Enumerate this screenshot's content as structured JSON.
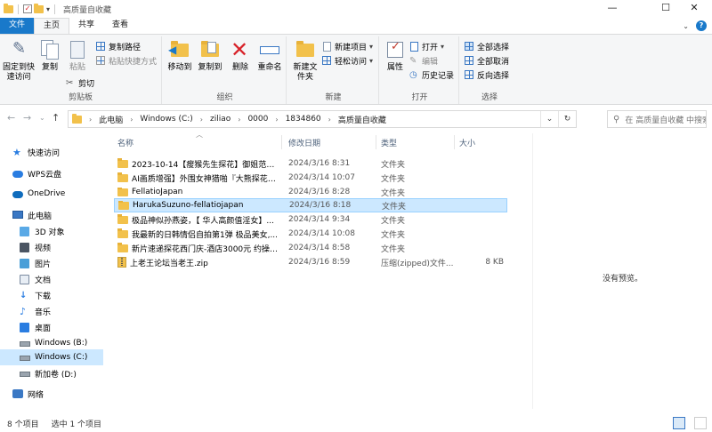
{
  "window": {
    "title": "高质量自收藏",
    "minimize": "—",
    "maximize": "☐",
    "close": "✕"
  },
  "tabs": [
    {
      "label": "文件"
    },
    {
      "label": "主页"
    },
    {
      "label": "共享"
    },
    {
      "label": "查看"
    }
  ],
  "ribbon": {
    "clipboard": {
      "label": "剪贴板",
      "pin": "固定到快速访问",
      "copy": "复制",
      "paste": "粘贴",
      "copy_path": "复制路径",
      "paste_shortcut": "粘贴快捷方式",
      "cut": "剪切"
    },
    "organize": {
      "label": "组织",
      "move_to": "移动到",
      "copy_to": "复制到",
      "delete": "删除",
      "rename": "重命名"
    },
    "new": {
      "label": "新建",
      "new_folder": "新建文件夹",
      "new_item": "新建项目",
      "easy_access": "轻松访问"
    },
    "open": {
      "label": "打开",
      "properties": "属性",
      "open": "打开",
      "edit": "编辑",
      "history": "历史记录"
    },
    "select": {
      "label": "选择",
      "select_all": "全部选择",
      "select_none": "全部取消",
      "invert": "反向选择"
    }
  },
  "address": {
    "crumbs": [
      "此电脑",
      "Windows (C:)",
      "ziliao",
      "0000",
      "1834860",
      "高质量自收藏"
    ],
    "search_placeholder": "在 高质量自收藏 中搜索"
  },
  "nav": [
    {
      "label": "快速访问",
      "icon": "star-icon"
    },
    {
      "label": "WPS云盘",
      "icon": "cloud-icon"
    },
    {
      "label": "OneDrive",
      "icon": "cloud-icon"
    },
    {
      "label": "此电脑",
      "icon": "computer-icon"
    },
    {
      "label": "3D 对象",
      "icon": "cube-icon"
    },
    {
      "label": "视频",
      "icon": "video-icon"
    },
    {
      "label": "图片",
      "icon": "picture-icon"
    },
    {
      "label": "文档",
      "icon": "document-icon"
    },
    {
      "label": "下载",
      "icon": "download-icon"
    },
    {
      "label": "音乐",
      "icon": "music-icon"
    },
    {
      "label": "桌面",
      "icon": "desktop-icon"
    },
    {
      "label": "Windows (B:)",
      "icon": "drive-icon"
    },
    {
      "label": "Windows (C:)",
      "icon": "drive-icon"
    },
    {
      "label": "新加卷 (D:)",
      "icon": "drive-icon"
    },
    {
      "label": "网络",
      "icon": "network-icon"
    }
  ],
  "columns": {
    "name": "名称",
    "date": "修改日期",
    "type": "类型",
    "size": "大小"
  },
  "files": [
    {
      "name": "2023-10-14【瘦猴先生探花】御姐范良...",
      "date": "2024/3/16 8:31",
      "type": "文件夹",
      "size": "",
      "kind": "folder"
    },
    {
      "name": "AI画质增强】外围女神猎啪『大熊探花』...",
      "date": "2024/3/14 10:07",
      "type": "文件夹",
      "size": "",
      "kind": "folder"
    },
    {
      "name": "FellatioJapan",
      "date": "2024/3/16 8:28",
      "type": "文件夹",
      "size": "",
      "kind": "folder"
    },
    {
      "name": "HarukaSuzuno-fellatiojapan",
      "date": "2024/3/16 8:18",
      "type": "文件夹",
      "size": "",
      "kind": "folder"
    },
    {
      "name": "极品神似孙燕姿，【 华人高颜值淫女】...",
      "date": "2024/3/14 9:34",
      "type": "文件夹",
      "size": "",
      "kind": "folder"
    },
    {
      "name": "我最新的日韩情侣自拍第1弹 极品美女,...",
      "date": "2024/3/14 10:08",
      "type": "文件夹",
      "size": "",
      "kind": "folder"
    },
    {
      "name": "新片速递探花西门庆-酒店3000元 约操气...",
      "date": "2024/3/14 8:58",
      "type": "文件夹",
      "size": "",
      "kind": "folder"
    },
    {
      "name": "上老王论坛当老王.zip",
      "date": "2024/3/16 8:59",
      "type": "压缩(zipped)文件...",
      "size": "8 KB",
      "kind": "zip"
    }
  ],
  "preview": {
    "text": "没有预览。"
  },
  "status": {
    "count": "8 个项目",
    "selected": "选中 1 个项目"
  }
}
